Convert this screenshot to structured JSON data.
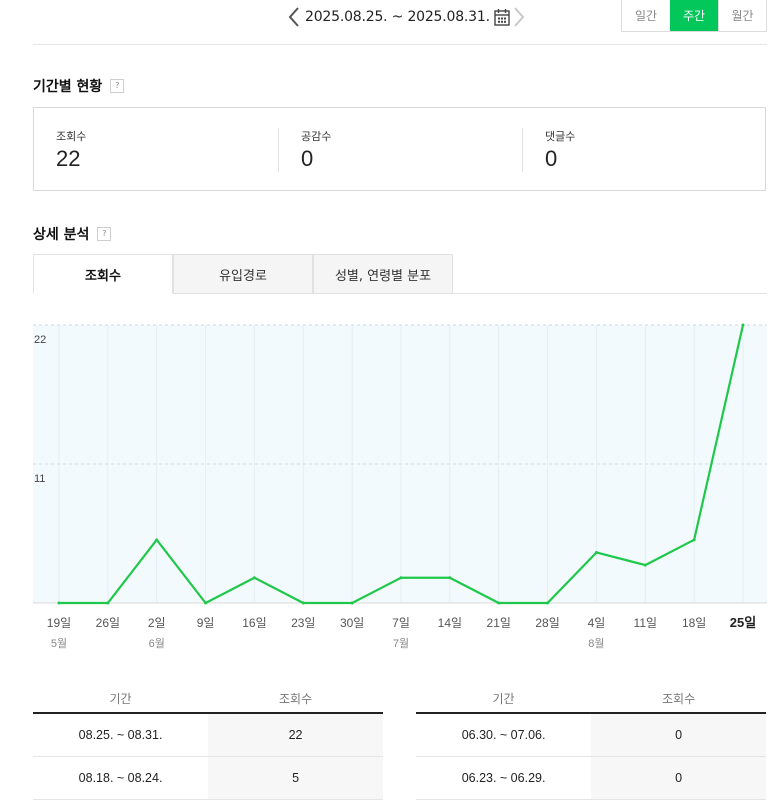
{
  "header": {
    "date_range": "2025.08.25. ~ 2025.08.31.",
    "period_tabs": [
      "일간",
      "주간",
      "월간"
    ],
    "active_period": "주간"
  },
  "summary": {
    "title": "기간별 현황",
    "help": "?",
    "stats": [
      {
        "label": "조회수",
        "value": "22"
      },
      {
        "label": "공감수",
        "value": "0"
      },
      {
        "label": "댓글수",
        "value": "0"
      }
    ]
  },
  "detail": {
    "title": "상세 분석",
    "help": "?",
    "tabs": [
      "조회수",
      "유입경로",
      "성별, 연령별 분포"
    ],
    "active_tab": "조회수"
  },
  "chart_data": {
    "type": "line",
    "x": [
      "19일",
      "26일",
      "2일",
      "9일",
      "16일",
      "23일",
      "30일",
      "7일",
      "14일",
      "21일",
      "28일",
      "4일",
      "11일",
      "18일",
      "25일"
    ],
    "month_labels": [
      {
        "index": 0,
        "label": "5월"
      },
      {
        "index": 2,
        "label": "6월"
      },
      {
        "index": 7,
        "label": "7월"
      },
      {
        "index": 11,
        "label": "8월"
      }
    ],
    "highlight_index": 14,
    "series": [
      {
        "values": [
          0,
          0,
          5,
          0,
          2,
          0,
          0,
          2,
          2,
          0,
          0,
          4,
          3,
          5,
          22
        ],
        "color": "#1fc84a"
      }
    ],
    "yticks": [
      11,
      22
    ],
    "ylim": [
      0,
      22
    ],
    "grid": true,
    "background": "#f3fafd"
  },
  "tables": [
    {
      "headers": [
        "기간",
        "조회수"
      ],
      "rows": [
        [
          "08.25. ~ 08.31.",
          "22"
        ],
        [
          "08.18. ~ 08.24.",
          "5"
        ]
      ]
    },
    {
      "headers": [
        "기간",
        "조회수"
      ],
      "rows": [
        [
          "06.30. ~ 07.06.",
          "0"
        ],
        [
          "06.23. ~ 06.29.",
          "0"
        ]
      ]
    }
  ]
}
